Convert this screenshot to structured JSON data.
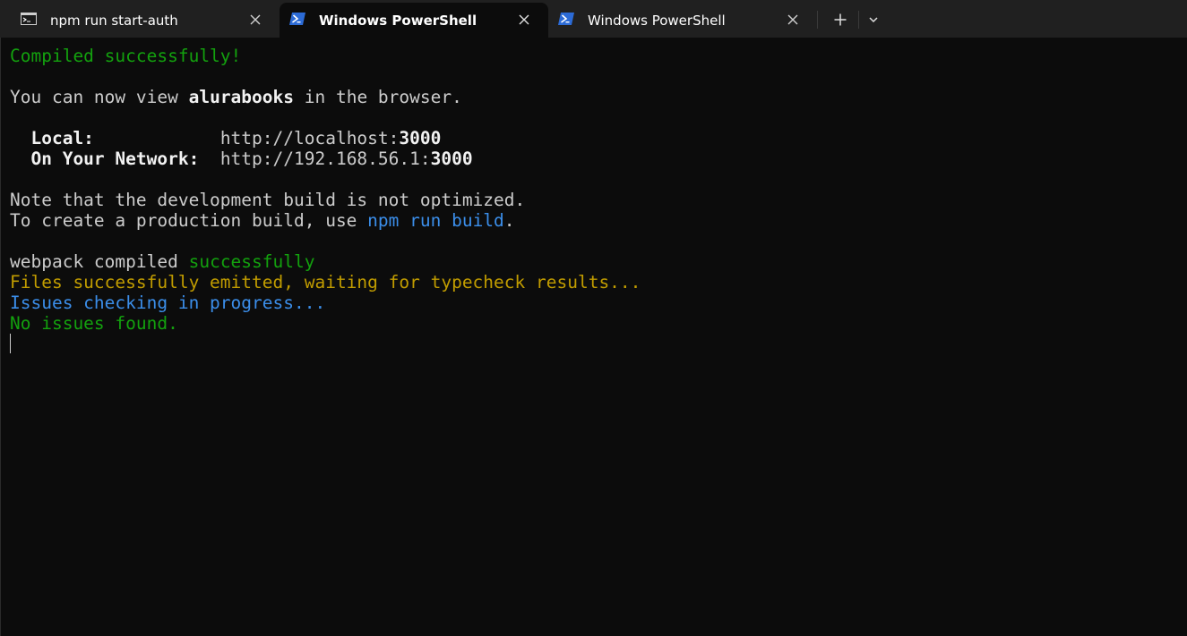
{
  "tabs": [
    {
      "title": "npm run start-auth",
      "icon": "cmd-icon",
      "active": false
    },
    {
      "title": "Windows PowerShell",
      "icon": "powershell-icon",
      "active": true
    },
    {
      "title": "Windows PowerShell",
      "icon": "powershell-icon",
      "active": false
    }
  ],
  "tab_actions": {
    "new_tab_icon": "plus-icon",
    "dropdown_icon": "chevron-down-icon"
  },
  "colors": {
    "background": "#0c0c0c",
    "tabbar": "#202020",
    "green": "#13a10e",
    "blue": "#3b8eea",
    "yellow": "#c19c00",
    "text": "#cccccc",
    "bright": "#f2f2f2"
  },
  "terminal": {
    "compiled": "Compiled successfully!",
    "view_prefix": "You can now view ",
    "app_name": "alurabooks",
    "view_suffix": " in the browser.",
    "local_label": "  Local:            ",
    "local_url_base": "http://localhost:",
    "local_port": "3000",
    "network_label": "  On Your Network:  ",
    "network_url_base": "http://192.168.56.1:",
    "network_port": "3000",
    "note": "Note that the development build is not optimized.",
    "prod_prefix": "To create a production build, use ",
    "prod_command": "npm run build",
    "prod_suffix": ".",
    "webpack_prefix": "webpack compiled ",
    "webpack_status": "successfully",
    "files_emitted": "Files successfully emitted, waiting for typecheck results...",
    "issues_checking": "Issues checking in progress...",
    "no_issues": "No issues found."
  }
}
